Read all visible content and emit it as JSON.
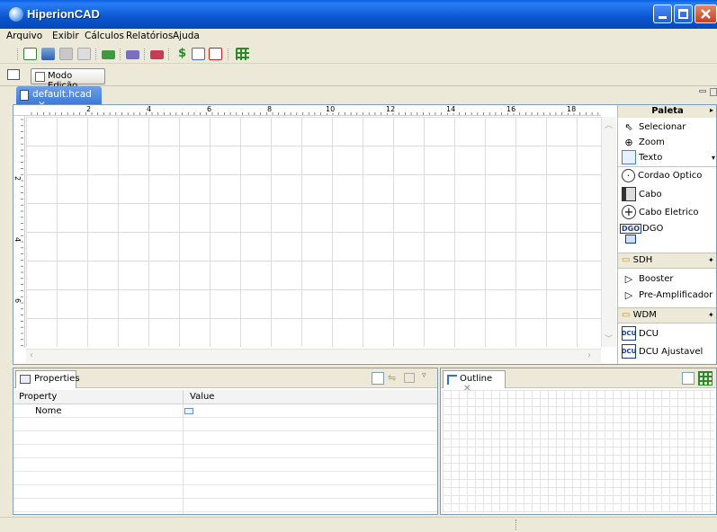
{
  "window": {
    "title": "HiperionCAD"
  },
  "menu": [
    "Arquivo",
    "Exibir",
    "Cálculos",
    "Relatórios",
    "Ajuda"
  ],
  "toolbar": {
    "icons": [
      "new-diagram-icon",
      "open-icon",
      "save-icon",
      "print-icon",
      "green-box-icon",
      "purple-box-icon",
      "red-box-icon",
      "dollar-icon",
      "rtf-icon",
      "pdf-icon",
      "grid-icon"
    ],
    "dollar_label": "$"
  },
  "mode_button": {
    "label": "Modo Edição"
  },
  "editor": {
    "tab_label": "default.hcad",
    "close_glyph": "✕"
  },
  "ruler": {
    "h_ticks": [
      "2",
      "4",
      "6",
      "8",
      "10",
      "12",
      "14",
      "16",
      "18"
    ],
    "v_ticks": [
      "2",
      "4",
      "6"
    ]
  },
  "palette": {
    "title": "Paleta",
    "tools": [
      {
        "label": "Selecionar",
        "icon": "arrow-icon"
      },
      {
        "label": "Zoom",
        "icon": "zoom-icon"
      },
      {
        "label": "Texto",
        "icon": "text-icon"
      }
    ],
    "items": [
      {
        "label": "Cordao Optico",
        "icon": "optical-cord-icon"
      },
      {
        "label": "Cabo",
        "icon": "cable-icon"
      },
      {
        "label": "Cabo Eletrico",
        "icon": "electric-cable-icon"
      },
      {
        "label": "DGO",
        "icon": "dgo-icon",
        "badge": "DGO"
      }
    ],
    "drawers": [
      {
        "label": "SDH",
        "items": [
          "Booster",
          "Pre-Amplificador"
        ]
      },
      {
        "label": "WDM",
        "items": [
          "DCU",
          "DCU Ajustavel"
        ]
      }
    ],
    "dcu_badge": "DCU"
  },
  "properties": {
    "tab_label": "Properties",
    "columns": [
      "Property",
      "Value"
    ],
    "rows": [
      {
        "name": "Nome",
        "value": ""
      }
    ]
  },
  "outline": {
    "tab_label": "Outline",
    "close_glyph": "✕"
  },
  "colors": {
    "titlebar": "#0a56d0",
    "selected_tab": "#3c79d8",
    "panel_border": "#7f9db9",
    "chrome": "#ece9d8"
  }
}
